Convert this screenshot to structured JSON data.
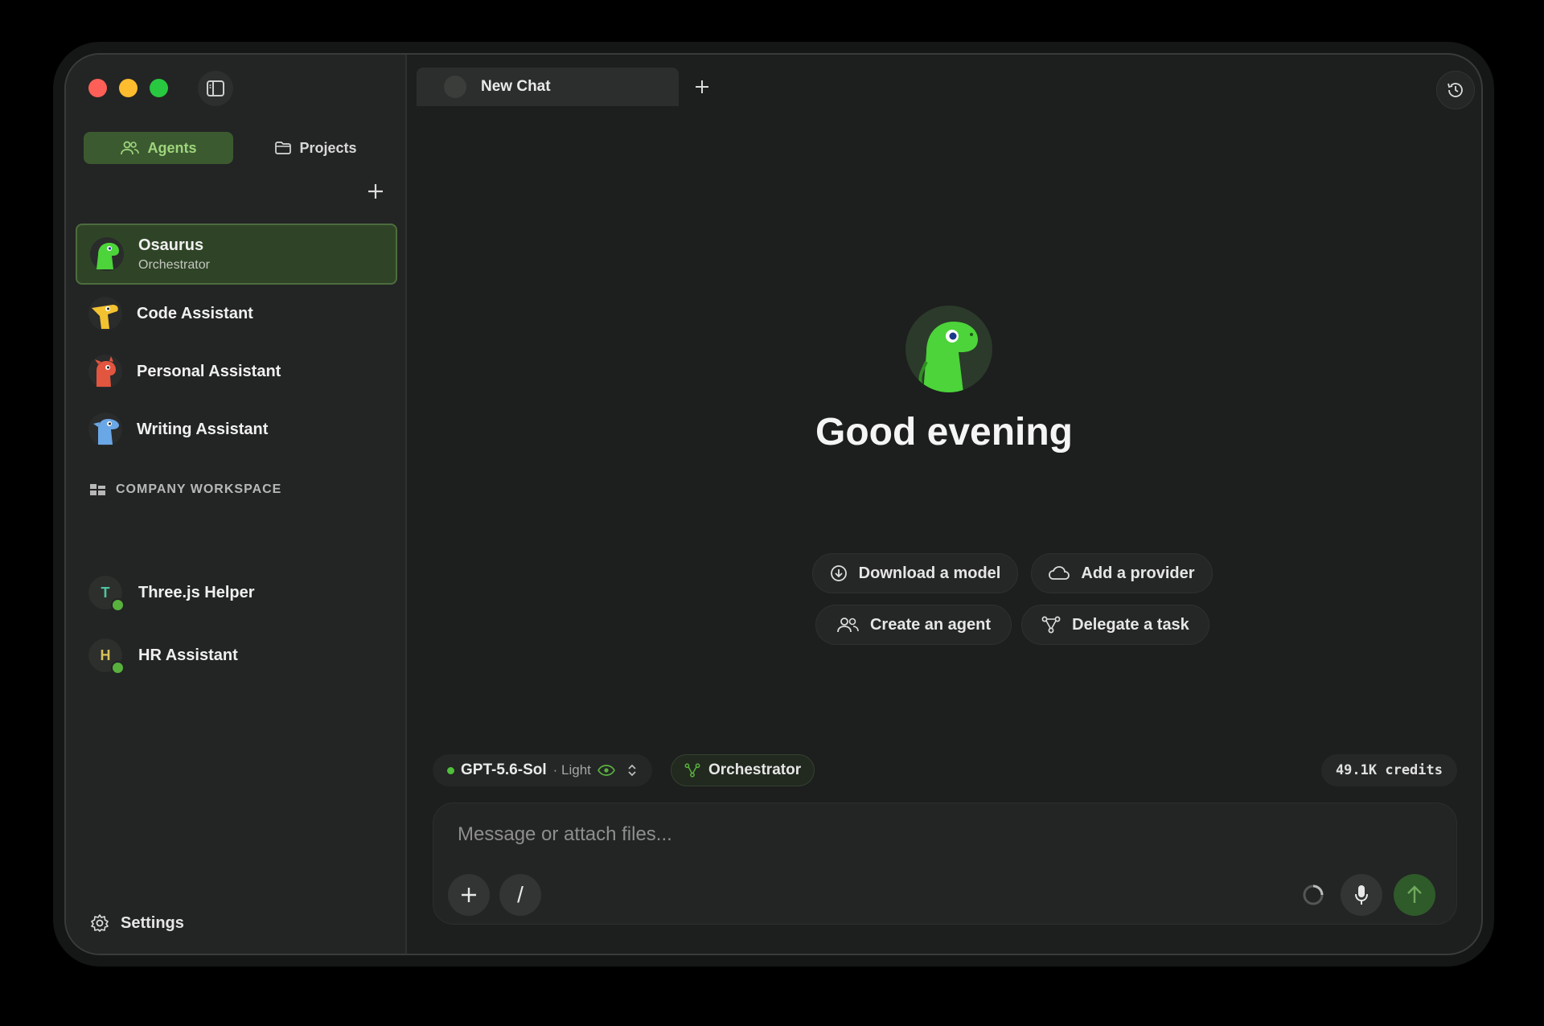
{
  "sidebar": {
    "tabs": [
      {
        "label": "Agents",
        "active": true
      },
      {
        "label": "Projects",
        "active": false
      }
    ],
    "agents": [
      {
        "name": "Osaurus",
        "subtitle": "Orchestrator",
        "active": true,
        "color": "#4cd43a"
      },
      {
        "name": "Code Assistant",
        "subtitle": "",
        "active": false,
        "color": "#f2c230"
      },
      {
        "name": "Personal Assistant",
        "subtitle": "",
        "active": false,
        "color": "#e2553f"
      },
      {
        "name": "Writing Assistant",
        "subtitle": "",
        "active": false,
        "color": "#6aa7e6"
      }
    ],
    "workspace": {
      "title": "COMPANY WORKSPACE",
      "items": [
        {
          "initial": "T",
          "name": "Three.js Helper",
          "initial_color": "#4fc3a1"
        },
        {
          "initial": "H",
          "name": "HR Assistant",
          "initial_color": "#d8c25b"
        }
      ]
    },
    "settings_label": "Settings"
  },
  "tab": {
    "title": "New Chat"
  },
  "hero": {
    "greeting": "Good evening"
  },
  "actions": [
    {
      "label": "Download a model",
      "icon": "download-icon"
    },
    {
      "label": "Add a provider",
      "icon": "cloud-icon"
    },
    {
      "label": "Create an agent",
      "icon": "users-icon"
    },
    {
      "label": "Delegate a task",
      "icon": "branch-icon"
    }
  ],
  "composer": {
    "model": "GPT-5.6-Sol",
    "mode": "· Light",
    "agent": "Orchestrator",
    "credits": "49.1K credits",
    "placeholder": "Message or attach files...",
    "slash": "/"
  },
  "colors": {
    "accent": "#58b13d",
    "accent_dark": "#3c5a30"
  }
}
